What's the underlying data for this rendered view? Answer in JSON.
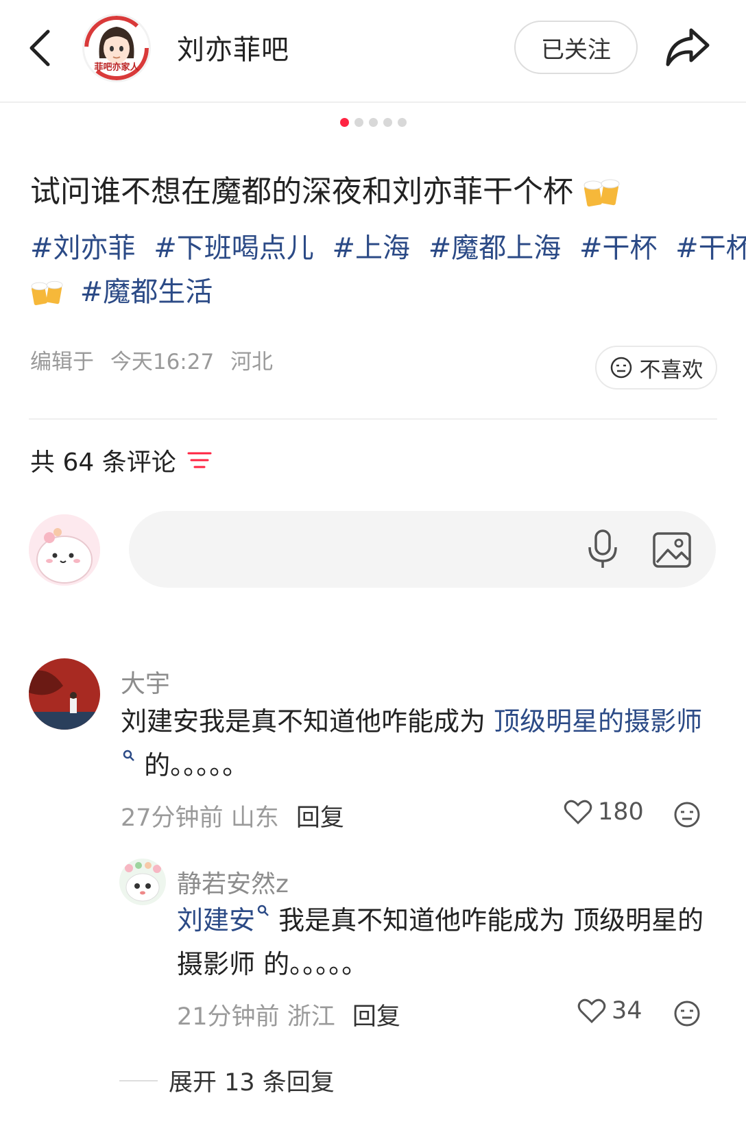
{
  "header": {
    "back_icon": "chevron-left-icon",
    "shop_name": "刘亦菲吧",
    "shop_avatar_text": "菲吧亦家人",
    "follow_label": "已关注",
    "share_icon": "share-arrow-icon"
  },
  "carousel": {
    "total": 5,
    "active": 1
  },
  "post": {
    "title": "试问谁不想在魔都的深夜和刘亦菲干个杯",
    "tags_line1": [
      "#刘亦菲",
      "#下班喝点儿",
      "#上海",
      "#魔都上海",
      "#干杯",
      "#干杯"
    ],
    "tags_line2": [
      "#魔都生活"
    ],
    "edited_label": "编辑于",
    "edited_time": "今天16:27",
    "location": "河北",
    "dislike_label": "不喜欢"
  },
  "comments_header": {
    "label": "共 64 条评论",
    "sort_icon": "sort-lines-icon"
  },
  "composer": {
    "placeholder": "",
    "mic_icon": "microphone-icon",
    "image_icon": "image-icon"
  },
  "comments": [
    {
      "user": "大宇",
      "text_before": "刘建安我是真不知道他咋能成为 ",
      "link": "顶级明星的摄影师",
      "text_after": " 的。。。。。",
      "time": "27分钟前",
      "location": "山东",
      "reply_label": "回复",
      "likes": "180"
    },
    {
      "user": "静若安然z",
      "link": "刘建安",
      "text_after": " 我是真不知道他咋能成为 顶级明星的摄影师  的。。。。。",
      "time": "21分钟前",
      "location": "浙江",
      "reply_label": "回复",
      "likes": "34"
    }
  ],
  "expand_label": "展开 13 条回复",
  "colors": {
    "accent": "#ff2442",
    "link": "#2b4a86",
    "muted": "#9a9a9a"
  }
}
